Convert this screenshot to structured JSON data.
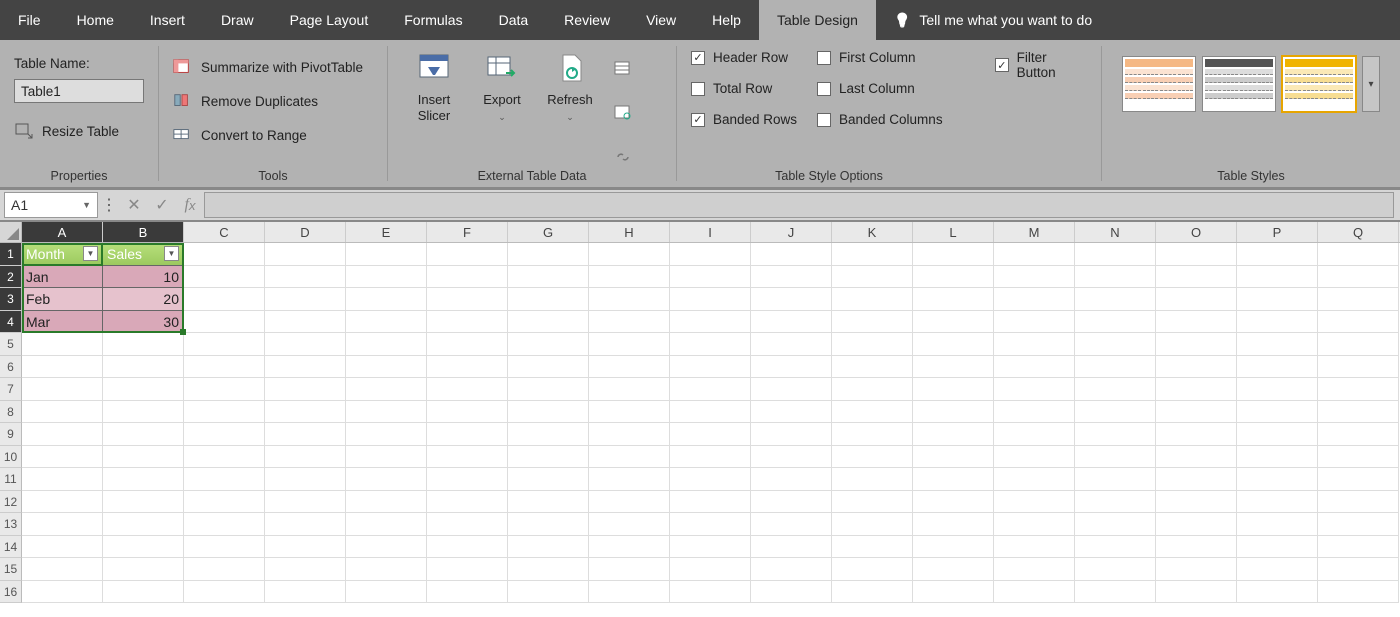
{
  "tabs": [
    "File",
    "Home",
    "Insert",
    "Draw",
    "Page Layout",
    "Formulas",
    "Data",
    "Review",
    "View",
    "Help",
    "Table Design"
  ],
  "active_tab": "Table Design",
  "tell_me": "Tell me what you want to do",
  "ribbon": {
    "properties": {
      "label": "Properties",
      "table_name_label": "Table Name:",
      "table_name_value": "Table1",
      "resize": "Resize Table"
    },
    "tools": {
      "label": "Tools",
      "pivot": "Summarize with PivotTable",
      "dup": "Remove Duplicates",
      "range": "Convert to Range"
    },
    "external": {
      "label": "External Table Data",
      "slicer": "Insert Slicer",
      "export": "Export",
      "refresh": "Refresh"
    },
    "styleopts": {
      "label": "Table Style Options",
      "header_row": "Header Row",
      "total_row": "Total Row",
      "banded_rows": "Banded Rows",
      "first_col": "First Column",
      "last_col": "Last Column",
      "banded_cols": "Banded Columns",
      "filter": "Filter Button",
      "checked": {
        "header_row": true,
        "total_row": false,
        "banded_rows": true,
        "first_col": false,
        "last_col": false,
        "banded_cols": false,
        "filter": true
      }
    },
    "styles": {
      "label": "Table Styles"
    }
  },
  "namebox": "A1",
  "columns": [
    "A",
    "B",
    "C",
    "D",
    "E",
    "F",
    "G",
    "H",
    "I",
    "J",
    "K",
    "L",
    "M",
    "N",
    "O",
    "P",
    "Q"
  ],
  "rows": 16,
  "table": {
    "headers": [
      "Month",
      "Sales"
    ],
    "data": [
      [
        "Jan",
        "10"
      ],
      [
        "Feb",
        "20"
      ],
      [
        "Mar",
        "30"
      ]
    ]
  }
}
